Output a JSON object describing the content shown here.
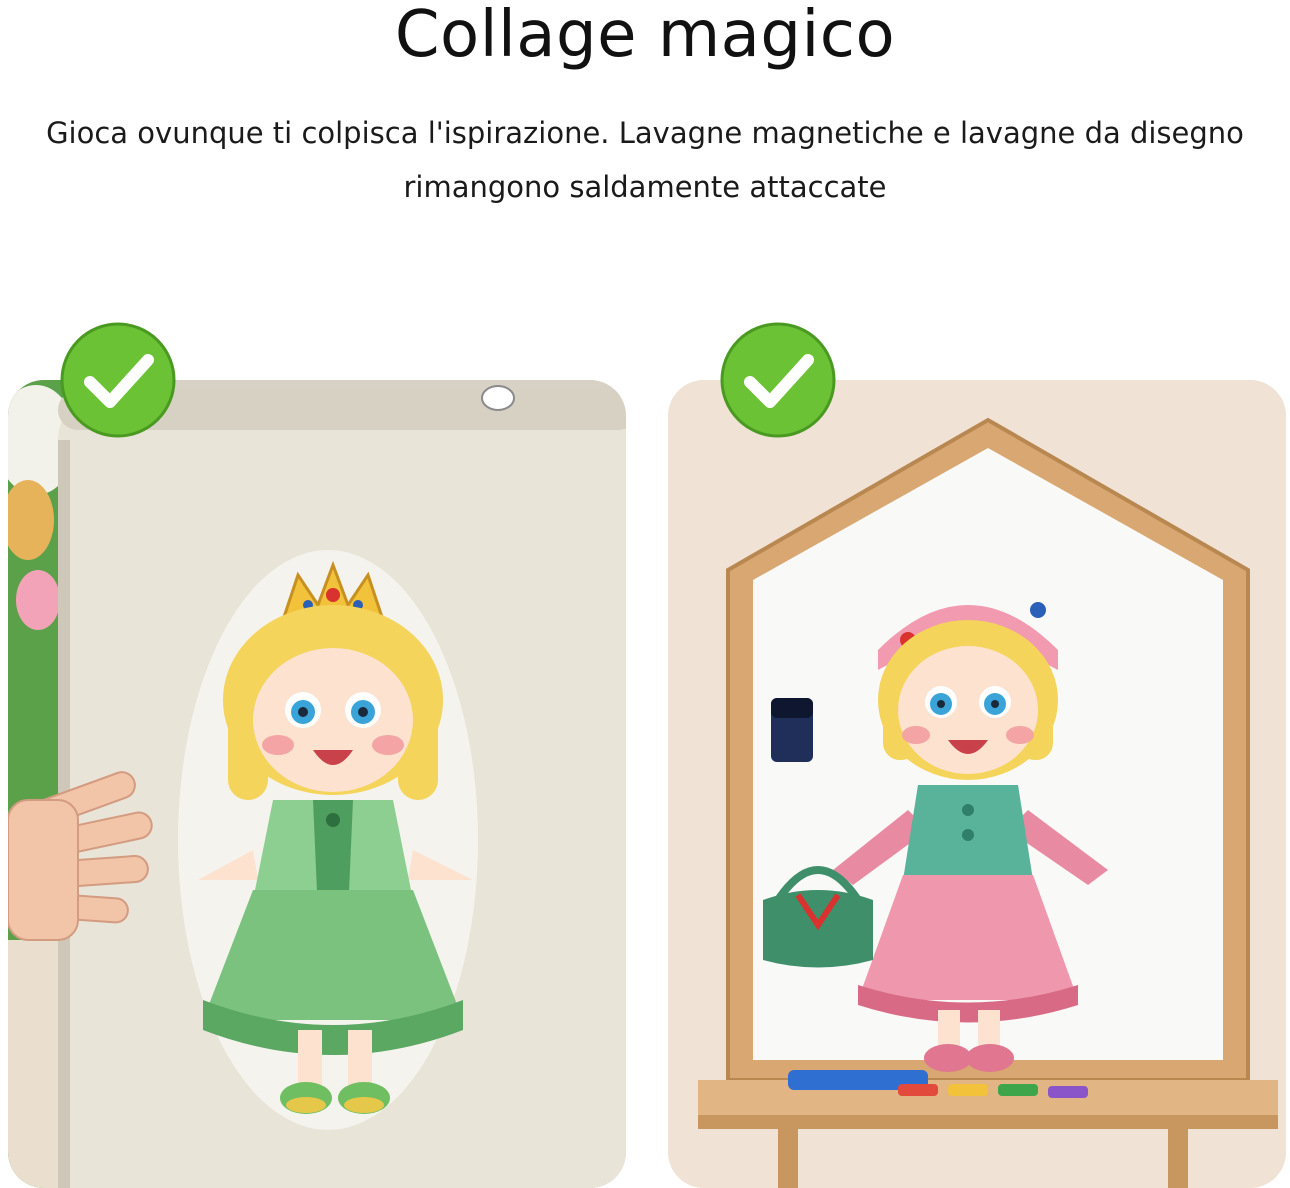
{
  "header": {
    "title": "Collage magico",
    "subtitle_line1": "Gioca ovunque ti colpisca l'ispirazione. Lavagne magnetiche e lavagne da disegno",
    "subtitle_line2": "rimangono saldamente attaccate"
  },
  "panels": [
    {
      "scene": "refrigerator-door-with-princess-doll-magnet",
      "badge_icon": "green-check-icon"
    },
    {
      "scene": "house-shaped-whiteboard-easel-with-girl-doll-magnet",
      "badge_icon": "green-check-icon"
    }
  ],
  "colors": {
    "check_green": "#6cc235",
    "fridge": "#e8e3d6",
    "wall": "#efe2d4",
    "wood": "#d9a771"
  }
}
